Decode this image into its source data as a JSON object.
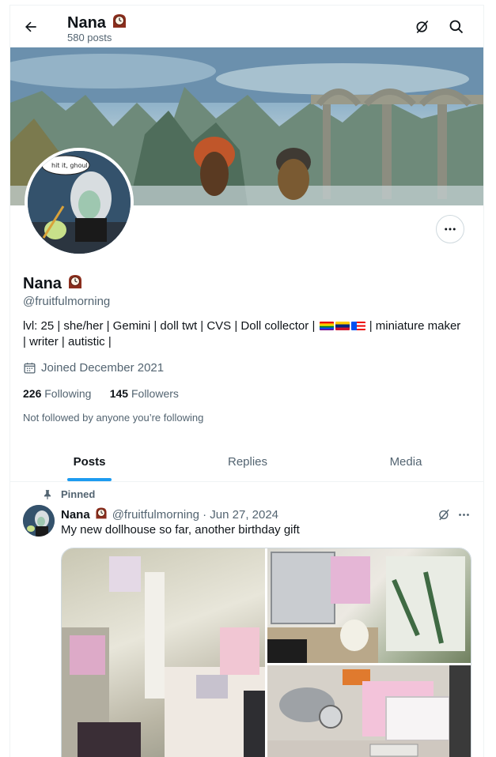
{
  "header": {
    "name": "Nana",
    "posts_count": "580 posts"
  },
  "profile": {
    "name": "Nana",
    "handle": "@fruitfulmorning",
    "bio_line1_a": "lvl: 25 | she/her | Gemini | doll twt | CVS | Doll collector |",
    "bio_line1_b": "| miniature maker",
    "bio_line2": "| writer | autistic |",
    "joined": "Joined December 2021",
    "following_count": "226",
    "following_label": "Following",
    "followers_count": "145",
    "followers_label": "Followers",
    "not_followed": "Not followed by anyone you’re following",
    "avatar_speech": "hit it, ghoul"
  },
  "tabs": [
    {
      "label": "Posts",
      "active": true
    },
    {
      "label": "Replies",
      "active": false
    },
    {
      "label": "Media",
      "active": false
    }
  ],
  "post": {
    "pinned_label": "Pinned",
    "author": "Nana",
    "meta": "@fruitfulmorning · Jun 27, 2024",
    "text": "My new dollhouse so far, another birthday gift"
  },
  "colors": {
    "accent": "#1d9bf0",
    "text": "#0f1419",
    "muted": "#536471"
  },
  "icons": {
    "back": "arrow-left-icon",
    "grok": "grok-icon",
    "search": "search-icon",
    "more": "more-horizontal-icon",
    "calendar": "calendar-icon",
    "pin": "pin-icon",
    "clock_emoji": "mantelpiece-clock-emoji"
  }
}
